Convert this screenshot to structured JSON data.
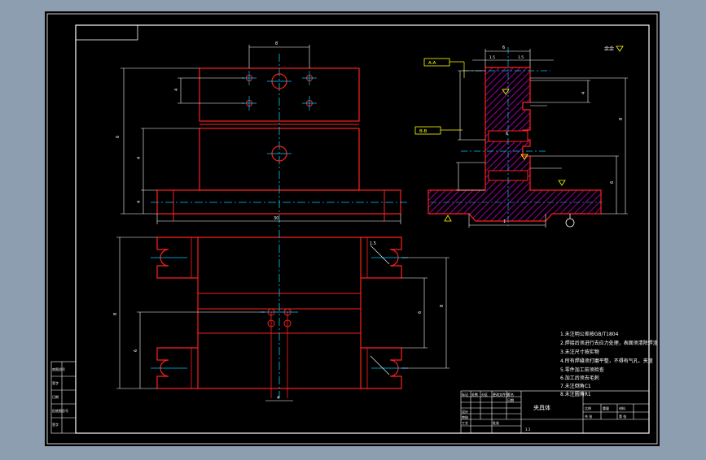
{
  "colors": {
    "background": "#8d9eb1",
    "canvas": "#000000",
    "outline": "#ff0000",
    "frame": "#ffffff",
    "centerline": "#00c8ff",
    "dimension": "#ffffff",
    "hatch": "#c000c0",
    "annotation": "#ffff00"
  },
  "dimensions": {
    "top_width": "8",
    "left_height": "6",
    "left_small": "4",
    "left_offset": "4",
    "left_lower": "4",
    "base_width": "30",
    "bottom_spacing": "4",
    "right_tall": "8",
    "right_inner": "6",
    "pitch": "1.5",
    "sec_top": "6",
    "sec_small_a": "1.5",
    "sec_small_b": "1.5",
    "sec_upper": "8",
    "sec_lower": "6",
    "sec_bottom": "8",
    "sec_mid_a": "6",
    "sec_mid_b": "6",
    "sec_left": "1",
    "sec_ra": "4"
  },
  "roughness": "余余",
  "section_labels": [
    "A-A",
    "B-B"
  ],
  "notes": [
    "1.未注明公差按GB/T1804",
    "2.焊接后须进行去应力处理，表面须清除焊渣",
    "3.未注尺寸按实物",
    "4.所有焊缝须打磨平整，不得有气孔、夹渣",
    "5.零件加工前须检查",
    "6.加工后须去毛刺",
    "7.未注倒角C1",
    "8.未注圆角R1"
  ],
  "title_block": {
    "part_name": "夹具体",
    "cells": [
      "标记",
      "处数",
      "分区",
      "更改文件号",
      "签名",
      "日期",
      "设计",
      "审核",
      "工艺",
      "批准",
      "比例",
      "重量",
      "材料",
      "共 张",
      "第 张",
      "1:1"
    ]
  },
  "side_table": [
    "底图总号",
    "签字",
    "日期",
    "旧底图总号",
    "签字"
  ]
}
